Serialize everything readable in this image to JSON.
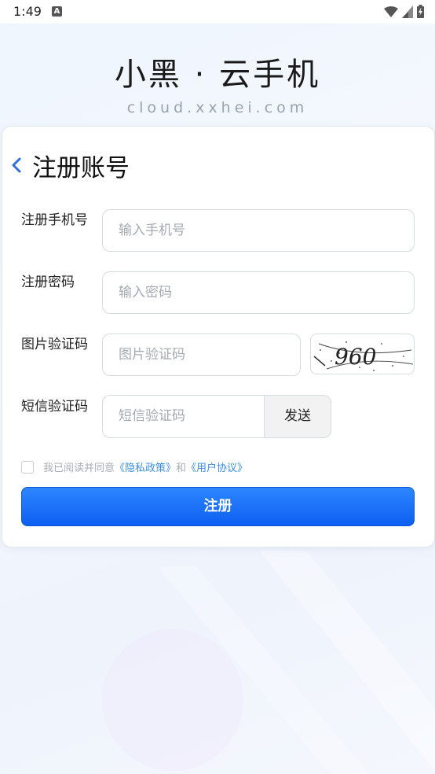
{
  "status_bar": {
    "time": "1:49",
    "notification_badge": "A"
  },
  "brand": {
    "title": "小黑 · 云手机",
    "subtitle": "cloud.xxhei.com"
  },
  "register": {
    "title": "注册账号",
    "fields": [
      {
        "label": "注册手机号",
        "placeholder": "输入手机号"
      },
      {
        "label": "注册密码",
        "placeholder": "输入密码"
      },
      {
        "label": "图片验证码",
        "placeholder": "图片验证码",
        "captcha_text": "960"
      },
      {
        "label": "短信验证码",
        "placeholder": "短信验证码",
        "send_label": "发送"
      }
    ],
    "agreement": {
      "prefix": "我已阅读并同意",
      "privacy_link": "《隐私政策》",
      "and": "和",
      "terms_link": "《用户协议》",
      "checked": false
    },
    "submit_label": "注册"
  },
  "colors": {
    "primary": "#1a6ff5",
    "link": "#3b8ede",
    "placeholder": "#a4aab1"
  }
}
